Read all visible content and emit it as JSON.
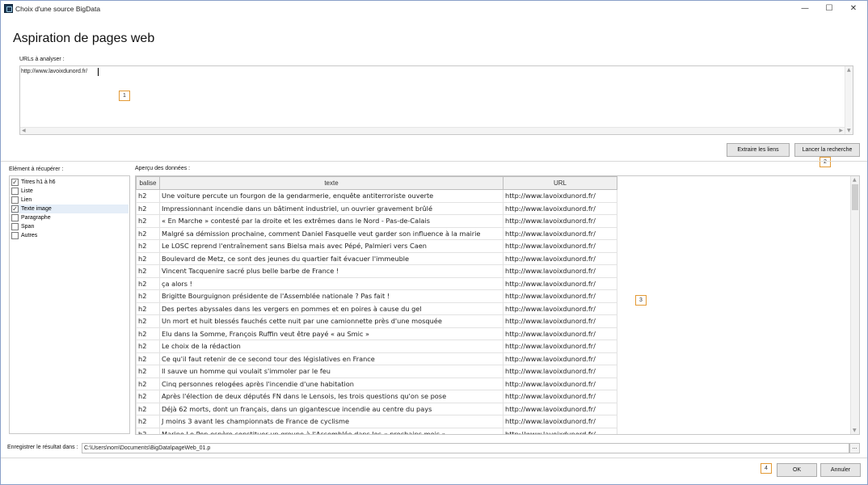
{
  "window": {
    "title": "Choix d'une source BigData",
    "minimize": "—",
    "maximize": "☐",
    "close": "✕"
  },
  "main_title": "Aspiration de pages web",
  "urls_label": "URLs à analyser :",
  "url_value": "http://www.lavoixdunord.fr/",
  "markers": [
    "1",
    "2",
    "3",
    "4"
  ],
  "buttons": {
    "extract_links": "Extraire les liens",
    "launch_search": "Lancer la recherche",
    "ok": "OK",
    "cancel": "Annuler",
    "browse": "..."
  },
  "elements_label": "Elément à récupérer :",
  "elements": [
    {
      "label": "Titres h1 à h6",
      "checked": true
    },
    {
      "label": "Liste",
      "checked": false
    },
    {
      "label": "Lien",
      "checked": false
    },
    {
      "label": "Texte image",
      "checked": true
    },
    {
      "label": "Paragraphe",
      "checked": false
    },
    {
      "label": "Span",
      "checked": false
    },
    {
      "label": "Autres",
      "checked": false
    }
  ],
  "preview_label": "Aperçu des données :",
  "grid": {
    "columns": [
      "balise",
      "texte",
      "URL"
    ],
    "rows": [
      [
        "h2",
        "Une voiture percute un fourgon de la gendarmerie, enquête antiterroriste ouverte",
        "http://www.lavoixdunord.fr/"
      ],
      [
        "h2",
        "Impressionnant incendie dans un bâtiment industriel, un ouvrier gravement brûlé",
        "http://www.lavoixdunord.fr/"
      ],
      [
        "h2",
        "« En Marche » contesté par la droite et les extrêmes dans le Nord - Pas-de-Calais",
        "http://www.lavoixdunord.fr/"
      ],
      [
        "h2",
        "Malgré sa démission prochaine, comment Daniel Fasquelle veut garder son influence à la mairie",
        "http://www.lavoixdunord.fr/"
      ],
      [
        "h2",
        "Le LOSC reprend l'entraînement sans Bielsa mais avec Pépé, Palmieri vers Caen",
        "http://www.lavoixdunord.fr/"
      ],
      [
        "h2",
        "Boulevard de Metz, ce sont des jeunes du quartier fait évacuer l'immeuble",
        "http://www.lavoixdunord.fr/"
      ],
      [
        "h2",
        "Vincent Tacquenire sacré plus belle barbe de France !",
        "http://www.lavoixdunord.fr/"
      ],
      [
        "h2",
        "ça alors !",
        "http://www.lavoixdunord.fr/"
      ],
      [
        "h2",
        "Brigitte Bourguignon présidente de l'Assemblée nationale ? Pas fait !",
        "http://www.lavoixdunord.fr/"
      ],
      [
        "h2",
        "Des pertes abyssales dans les vergers en pommes et en poires à cause du gel",
        "http://www.lavoixdunord.fr/"
      ],
      [
        "h2",
        "Un mort et huit blessés fauchés cette nuit par une camionnette près d'une mosquée",
        "http://www.lavoixdunord.fr/"
      ],
      [
        "h2",
        "Elu dans la Somme, François Ruffin veut être payé « au Smic »",
        "http://www.lavoixdunord.fr/"
      ],
      [
        "h2",
        "Le choix de la rédaction",
        "http://www.lavoixdunord.fr/"
      ],
      [
        "h2",
        "Ce qu'il faut retenir de ce second tour des législatives en France",
        "http://www.lavoixdunord.fr/"
      ],
      [
        "h2",
        "Il sauve un homme qui voulait s'immoler par le feu",
        "http://www.lavoixdunord.fr/"
      ],
      [
        "h2",
        "Cinq personnes relogées après l'incendie d'une habitation",
        "http://www.lavoixdunord.fr/"
      ],
      [
        "h2",
        "Après l'élection de deux députés FN dans le Lensois, les trois questions qu'on se pose",
        "http://www.lavoixdunord.fr/"
      ],
      [
        "h2",
        "Déjà 62 morts, dont un français, dans un gigantescue incendie au centre du pays",
        "http://www.lavoixdunord.fr/"
      ],
      [
        "h2",
        "J moins 3 avant les championnats de France de cyclisme",
        "http://www.lavoixdunord.fr/"
      ],
      [
        "h2",
        "Marine Le Pen espère constituer un groupe à l'Assemblée dans les « prochains mois »",
        "http://www.lavoixdunord.fr/"
      ]
    ]
  },
  "save_label": "Enregistrer le résultat dans :",
  "save_path": "C:\\Users\\nom\\Documents\\BigData\\pageWeb_01.p"
}
